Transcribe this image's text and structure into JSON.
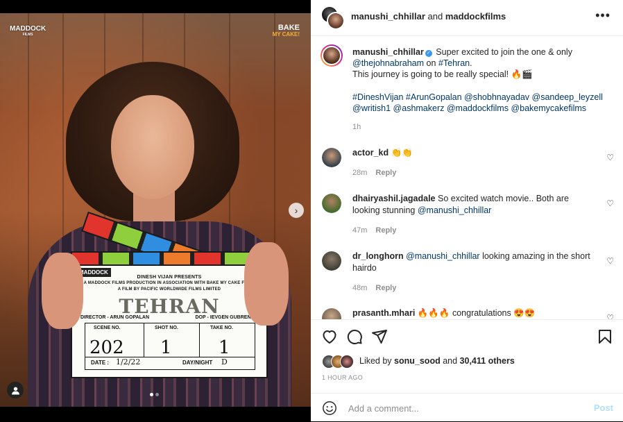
{
  "media": {
    "watermark_left": "MADDOCK",
    "watermark_left_sub": "FILMS",
    "watermark_right_line1": "BAKE",
    "watermark_right_line2": "MY CAKE!",
    "slide_count": 2,
    "active_slide": 1,
    "clapper": {
      "logo": "MADDOCK",
      "line1": "DINESH VIJAN PRESENTS",
      "line2": "A MADDOCK FILMS PRODUCTION IN ASSOCIATION WITH BAKE MY CAKE FILMS",
      "line3": "A FILM BY PACIFIC WORLDWIDE FILMS LIMITED",
      "title": "TEHRAN",
      "director": "DIRECTOR - ARUN GOPALAN",
      "dop": "DOP - IEVGEN GUBRENKO",
      "scene_label": "SCENE NO.",
      "shot_label": "SHOT NO.",
      "take_label": "TAKE NO.",
      "scene_value": "202",
      "shot_value": "1",
      "take_value": "1",
      "date_label": "DATE :",
      "date_value": "1/2/22",
      "daynight_label": "DAY/NIGHT",
      "daynight_value": "D"
    }
  },
  "header": {
    "user1": "manushi_chhillar",
    "connector": "and",
    "user2": "maddockfilms",
    "more_icon": "more-horizontal-icon"
  },
  "caption": {
    "username": "manushi_chhillar",
    "line1": "Super excited to join the one & only",
    "mention1": "@thejohnabraham",
    "on_word": "on",
    "hashtag_tehran": "#Tehran",
    "period": ".",
    "line2": "This journey is going to be really special! 🔥🎬",
    "tags": [
      "#DineshVijan",
      "#ArunGopalan",
      "@shobhnayadav",
      "@sandeep_leyzell",
      "@writish1",
      "@ashmakerz",
      "@maddockfilms",
      "@bakemycakefilms"
    ],
    "time": "1h"
  },
  "comments": [
    {
      "username": "actor_kd",
      "text": "👏👏",
      "time": "28m",
      "reply": "Reply"
    },
    {
      "username": "dhairyashil.jagadale",
      "text": "So excited watch movie.. Both are looking stunning",
      "mention": "@manushi_chhillar",
      "time": "47m",
      "reply": "Reply"
    },
    {
      "username": "dr_longhorn",
      "mention": "@manushi_chhillar",
      "text": "looking amazing in the short hairdo",
      "time": "48m",
      "reply": "Reply"
    },
    {
      "username": "prasanth.mhari",
      "text": "🔥🔥🔥 congratulations 😍😍",
      "time": "",
      "reply": ""
    }
  ],
  "likes": {
    "prefix": "Liked by",
    "user": "sonu_sood",
    "middle": "and",
    "count": "30,411 others"
  },
  "timestamp": "1 HOUR AGO",
  "add_comment": {
    "placeholder": "Add a comment...",
    "post_label": "Post"
  },
  "colors": {
    "link": "#00376b",
    "post_disabled": "#b2dffc",
    "verified": "#3897f0"
  }
}
